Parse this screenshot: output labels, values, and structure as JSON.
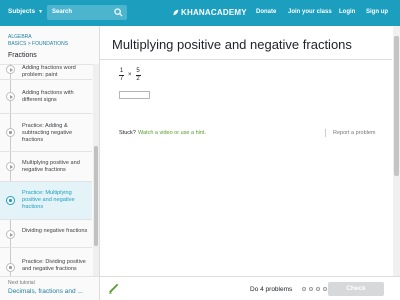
{
  "topbar": {
    "subjects_label": "Subjects",
    "search_placeholder": "Search",
    "logo_text": "KHANACADEMY",
    "donate": "Donate",
    "join_class": "Join your class",
    "login": "Login",
    "signup": "Sign up",
    "colors": {
      "bar": "#1c9fbf"
    }
  },
  "sidebar": {
    "breadcrumb_line1": "ALGEBRA",
    "breadcrumb_line2": "BASICS > FOUNDATIONS",
    "section_title": "Fractions",
    "items": [
      {
        "label": "Adding fractions word problem: paint",
        "icon": "play-icon",
        "active": false
      },
      {
        "label": "Adding fractions with different signs",
        "icon": "play-icon",
        "active": false
      },
      {
        "label": "Practice: Adding & subtracting negative fractions",
        "icon": "star-icon",
        "active": false
      },
      {
        "label": "Multiplying positive and negative fractions",
        "icon": "play-icon",
        "active": false
      },
      {
        "label": "Practice: Multiplying positive and negative fractions",
        "icon": "star-icon",
        "active": true
      },
      {
        "label": "Dividing negative fractions",
        "icon": "play-icon",
        "active": false
      },
      {
        "label": "Practice: Dividing positive and negative fractions",
        "icon": "star-icon",
        "active": false
      }
    ],
    "next_tutorial_label": "Next tutorial",
    "next_tutorial_title": "Decimals, fractions and ..."
  },
  "main": {
    "title": "Multiplying positive and negative fractions",
    "problem": {
      "frac1": {
        "num": "1",
        "den": "7"
      },
      "operator": "×",
      "frac2": {
        "num": "5",
        "den": "2"
      },
      "answer_value": ""
    },
    "stuck_label": "Stuck?",
    "hint_link": "Watch a video or use a hint.",
    "report_link": "Report a problem"
  },
  "bottombar": {
    "do_label": "Do 4 problems",
    "progress_dots": 4,
    "check_label": "Check"
  }
}
